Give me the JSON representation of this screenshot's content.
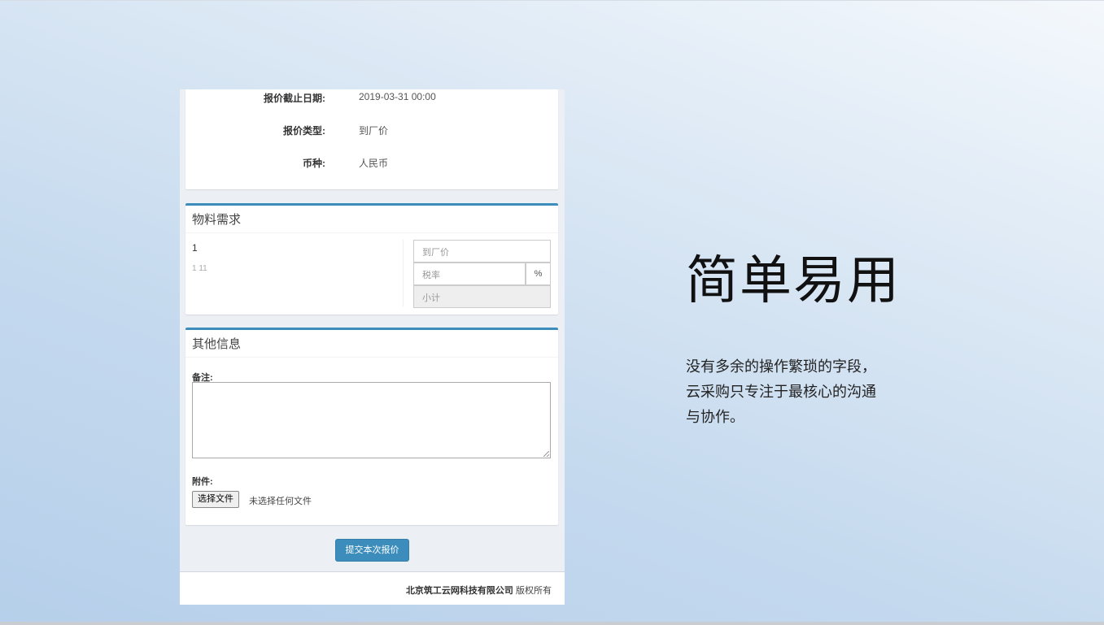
{
  "info": {
    "rows": [
      {
        "label": "报价截止日期:",
        "value": "2019-03-31 00:00"
      },
      {
        "label": "报价类型:",
        "value": "到厂价"
      },
      {
        "label": "币种:",
        "value": "人民币"
      }
    ]
  },
  "material": {
    "title": "物料需求",
    "item_name": "1",
    "item_sub": "1  11",
    "price_placeholder": "到厂价",
    "tax_placeholder": "税率",
    "tax_unit": "%",
    "subtotal_placeholder": "小计"
  },
  "other": {
    "title": "其他信息",
    "remark_label": "备注:",
    "attachment_label": "附件:",
    "choose_file_label": "选择文件",
    "no_file_text": "未选择任何文件"
  },
  "submit_label": "提交本次报价",
  "footer": {
    "company": "北京筑工云网科技有限公司",
    "rights": "版权所有"
  },
  "promo": {
    "headline": "简单易用",
    "description": "没有多余的操作繁琐的字段，云采购只专注于最核心的沟通与协作。"
  },
  "colors": {
    "accent": "#3c8dbc",
    "panel_background": "#ecf0f5"
  }
}
